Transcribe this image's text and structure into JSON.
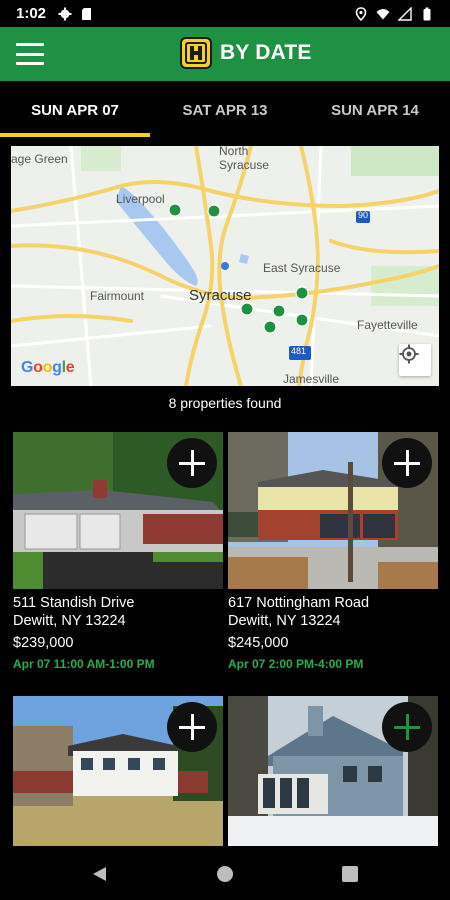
{
  "status_bar": {
    "time": "1:02"
  },
  "app_bar": {
    "title": "BY DATE"
  },
  "tabs": [
    {
      "label": "SUN APR 07",
      "active": true
    },
    {
      "label": "SAT APR 13",
      "active": false
    },
    {
      "label": "SUN APR 14",
      "active": false
    }
  ],
  "map": {
    "labels": {
      "sage_green": "age Green",
      "north_syracuse": "North\nSyracuse",
      "liverpool": "Liverpool",
      "fairmount": "Fairmount",
      "syracuse": "Syracuse",
      "east_syracuse": "East Syracuse",
      "fayetteville": "Fayetteville",
      "jamesville": "Jamesville",
      "hwy90": "90",
      "hwy481": "481"
    },
    "google": "Google"
  },
  "results": {
    "text": "8 properties found"
  },
  "listings": [
    {
      "street": "511 Standish Drive",
      "city": "Dewitt, NY 13224",
      "price": "$239,000",
      "time": "Apr 07 11:00 AM-1:00 PM",
      "added": false
    },
    {
      "street": "617 Nottingham Road",
      "city": "Dewitt, NY 13224",
      "price": "$245,000",
      "time": "Apr 07 2:00 PM-4:00 PM",
      "added": false
    },
    {
      "street": "",
      "city": "",
      "price": "",
      "time": "",
      "added": false
    },
    {
      "street": "",
      "city": "",
      "price": "",
      "time": "",
      "added": true
    }
  ],
  "colors": {
    "brand_green": "#1f9142",
    "accent_yellow": "#f4d21f",
    "time_green": "#22b04e"
  }
}
